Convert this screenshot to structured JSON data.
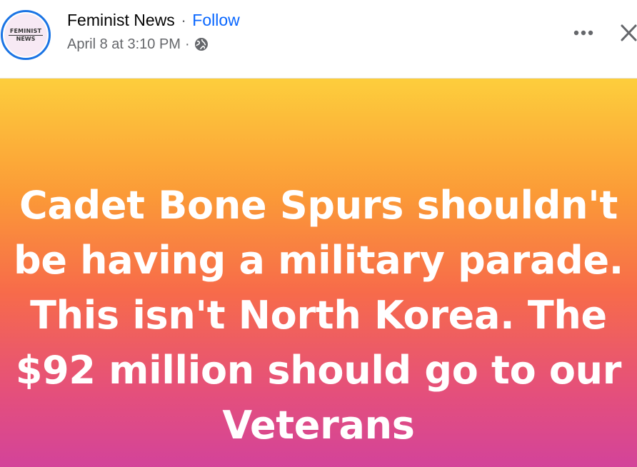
{
  "post": {
    "author": {
      "name": "Feminist News",
      "separator": "·",
      "follow_label": "Follow",
      "avatar_line1": "FEMINIST",
      "avatar_line2": "NEWS"
    },
    "timestamp": "April 8 at 3:10 PM",
    "meta_separator": "·",
    "privacy_icon": "globe-icon",
    "actions": {
      "more_icon": "more-dots-icon",
      "close_icon": "close-icon"
    },
    "status": {
      "text": "Cadet Bone Spurs shouldn't be having a military parade. This isn't North Korea. The $92 million should go to our Veterans",
      "gradient_colors": [
        "#fdce3c",
        "#fb9a37",
        "#f76b4a",
        "#e5507a",
        "#d3439a"
      ],
      "text_color": "#ffffff"
    },
    "colors": {
      "follow_link": "#0866ff",
      "avatar_ring": "#1b74e4",
      "meta_text": "#65676b"
    }
  }
}
